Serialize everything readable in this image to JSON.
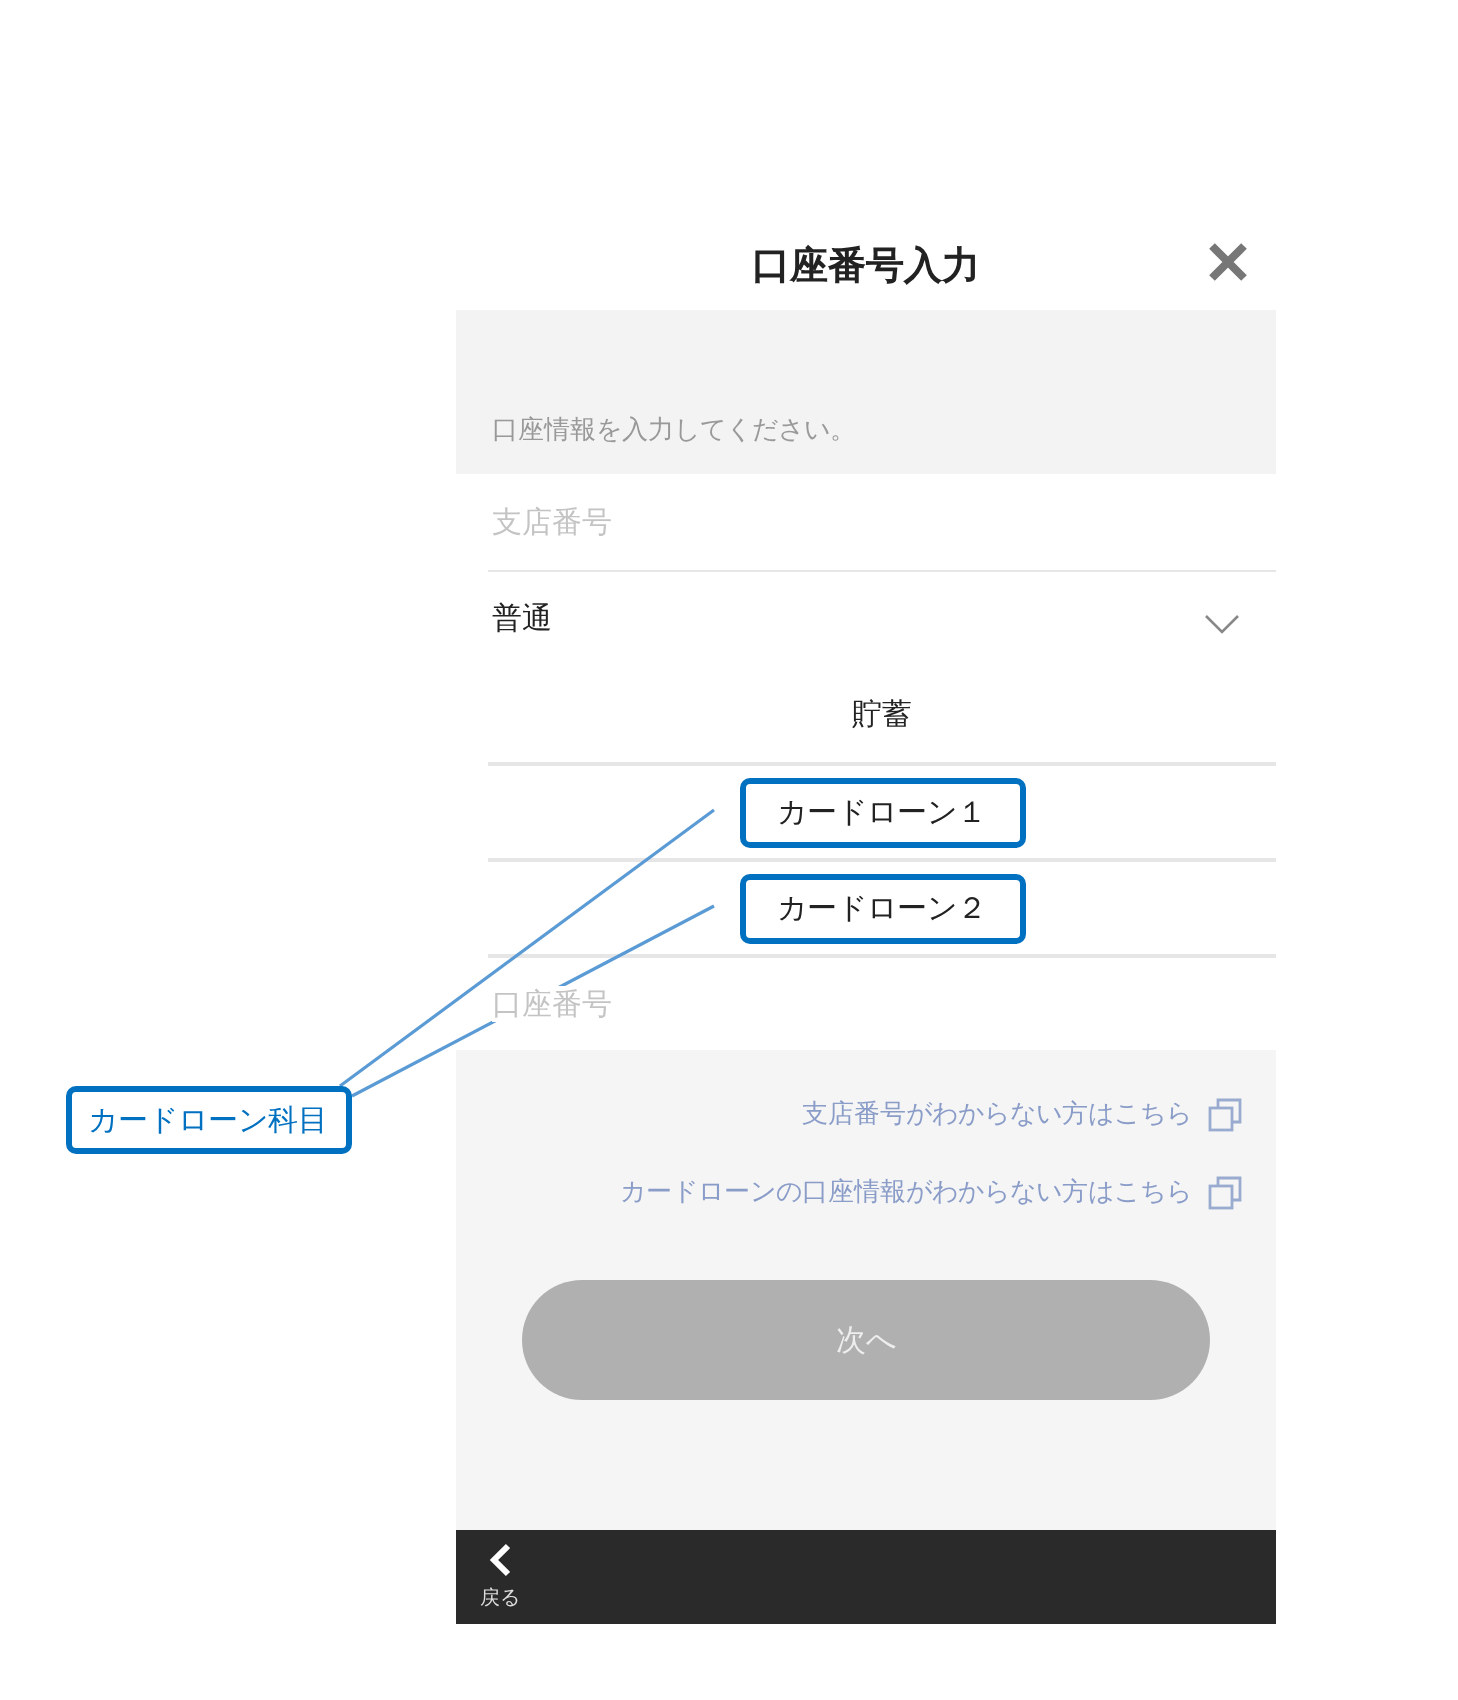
{
  "header": {
    "title": "口座番号入力"
  },
  "intro": "口座情報を入力してください。",
  "branch_field": {
    "placeholder": "支店番号"
  },
  "account_type": {
    "value": "普通",
    "options": [
      {
        "label": "貯蓄",
        "highlighted": false
      },
      {
        "label": "カードローン１",
        "highlighted": true
      },
      {
        "label": "カードローン２",
        "highlighted": true
      }
    ]
  },
  "account_field": {
    "placeholder": "口座番号"
  },
  "links": [
    "支店番号がわからない方はこちら",
    "カードローンの口座情報がわからない方はこちら"
  ],
  "next_button": {
    "label": "次へ",
    "disabled": true
  },
  "footer": {
    "back": "戻る"
  },
  "annotation": {
    "label": "カードローン科目"
  }
}
